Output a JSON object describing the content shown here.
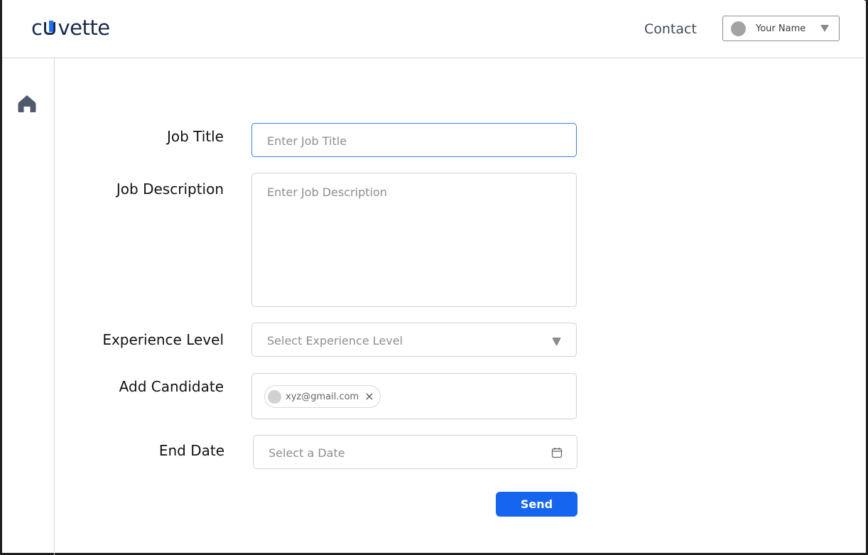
{
  "header": {
    "logo": {
      "left": "c",
      "right": "vette"
    },
    "contact_label": "Contact",
    "user": {
      "name": "Your Name"
    }
  },
  "sidebar": {
    "items": [
      {
        "icon": "home-icon"
      }
    ]
  },
  "form": {
    "job_title": {
      "label": "Job Title",
      "placeholder": "Enter Job Title",
      "value": ""
    },
    "job_description": {
      "label": "Job Description",
      "placeholder": "Enter Job Description",
      "value": ""
    },
    "experience_level": {
      "label": "Experience Level",
      "placeholder": "Select Experience Level",
      "selected": ""
    },
    "add_candidate": {
      "label": "Add Candidate",
      "candidates": [
        {
          "email": "xyz@gmail.com"
        }
      ]
    },
    "end_date": {
      "label": "End Date",
      "placeholder": "Select a Date",
      "value": ""
    },
    "submit_label": "Send"
  },
  "colors": {
    "accent": "#1565ef",
    "brand_dark": "#1b2a4e",
    "focus_border": "#3d7fdb"
  }
}
